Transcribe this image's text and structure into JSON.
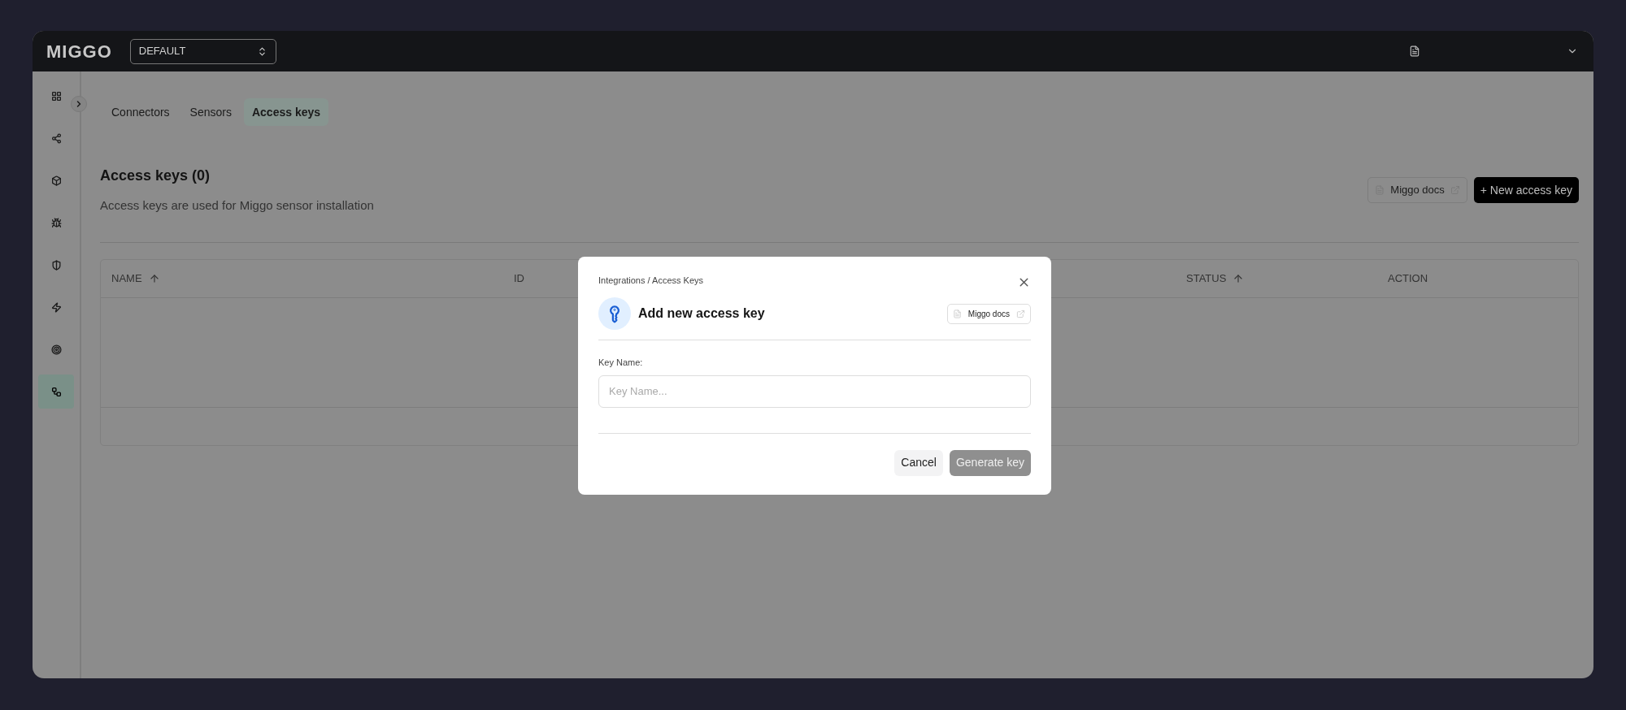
{
  "topbar": {
    "logo": "MIGGO",
    "workspace_select": {
      "value": "DEFAULT"
    }
  },
  "sidebar": {
    "items": [
      {
        "selected": false
      },
      {
        "selected": false
      },
      {
        "selected": false
      },
      {
        "selected": false
      },
      {
        "selected": false
      },
      {
        "selected": false
      },
      {
        "selected": false
      },
      {
        "selected": true
      }
    ]
  },
  "tabs": [
    {
      "label": "Connectors",
      "selected": false
    },
    {
      "label": "Sensors",
      "selected": false
    },
    {
      "label": "Access keys",
      "selected": true
    }
  ],
  "header": {
    "title": "Access keys (0)",
    "subtitle": "Access keys are used for Miggo sensor installation",
    "docs_button": "Miggo docs",
    "new_button": "+ New access key"
  },
  "table": {
    "columns": [
      {
        "label": "NAME",
        "sorted": true
      },
      {
        "label": "ID",
        "sorted": false
      },
      {
        "label": "STATUS",
        "sorted": true
      },
      {
        "label": "ACTION",
        "sorted": false
      }
    ]
  },
  "modal": {
    "breadcrumb": "Integrations / Access Keys",
    "title": "Add new access key",
    "docs_button": "Miggo docs",
    "field_label": "Key Name:",
    "placeholder": "Key Name...",
    "cancel_button": "Cancel",
    "generate_button": {
      "label": "Generate key",
      "disabled": true
    }
  }
}
